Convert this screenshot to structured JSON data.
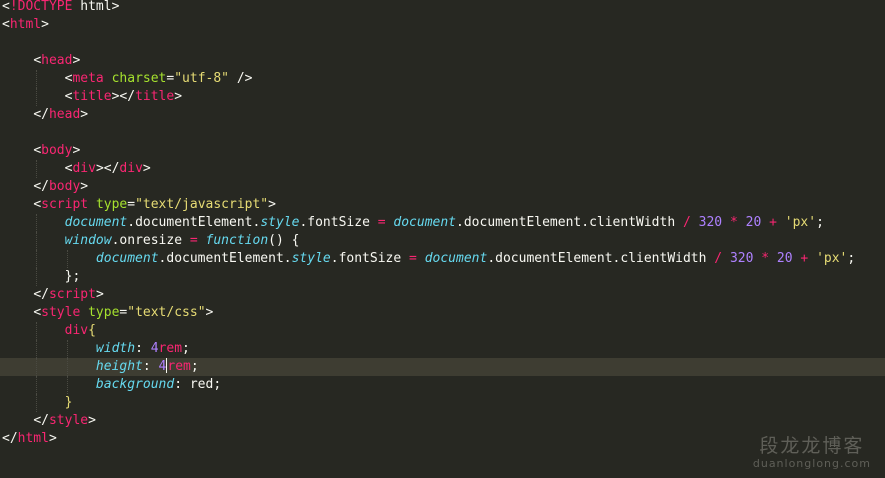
{
  "editor": {
    "theme": "monokai",
    "colors": {
      "background": "#272822",
      "active_line": "#3E3D32",
      "tag": "#F92672",
      "attribute": "#A6E22E",
      "string": "#E6DB74",
      "keyword_italic": "#66D9EF",
      "number": "#AE81FF",
      "text": "#F8F8F2"
    },
    "active_line_index": 20,
    "lines": [
      [
        {
          "c": "tok-punct",
          "t": "<"
        },
        {
          "c": "tok-tag",
          "t": "!DOCTYPE"
        },
        {
          "c": "tok-text",
          "t": " html>"
        }
      ],
      [
        {
          "c": "tok-punct",
          "t": "<"
        },
        {
          "c": "tok-tag",
          "t": "html"
        },
        {
          "c": "tok-punct",
          "t": ">"
        }
      ],
      [],
      [
        {
          "c": "tok-text",
          "t": "    "
        },
        {
          "c": "tok-punct",
          "t": "<"
        },
        {
          "c": "tok-tag",
          "t": "head"
        },
        {
          "c": "tok-punct",
          "t": ">"
        }
      ],
      [
        {
          "c": "tok-text",
          "t": "        "
        },
        {
          "c": "tok-punct",
          "t": "<"
        },
        {
          "c": "tok-tag",
          "t": "meta"
        },
        {
          "c": "tok-text",
          "t": " "
        },
        {
          "c": "tok-attr",
          "t": "charset"
        },
        {
          "c": "tok-punct",
          "t": "="
        },
        {
          "c": "tok-str",
          "t": "\"utf-8\""
        },
        {
          "c": "tok-text",
          "t": " />"
        }
      ],
      [
        {
          "c": "tok-text",
          "t": "        "
        },
        {
          "c": "tok-punct",
          "t": "<"
        },
        {
          "c": "tok-tag",
          "t": "title"
        },
        {
          "c": "tok-punct",
          "t": "></"
        },
        {
          "c": "tok-tag",
          "t": "title"
        },
        {
          "c": "tok-punct",
          "t": ">"
        }
      ],
      [
        {
          "c": "tok-text",
          "t": "    "
        },
        {
          "c": "tok-punct",
          "t": "</"
        },
        {
          "c": "tok-tag",
          "t": "head"
        },
        {
          "c": "tok-punct",
          "t": ">"
        }
      ],
      [],
      [
        {
          "c": "tok-text",
          "t": "    "
        },
        {
          "c": "tok-punct",
          "t": "<"
        },
        {
          "c": "tok-tag",
          "t": "body"
        },
        {
          "c": "tok-punct",
          "t": ">"
        }
      ],
      [
        {
          "c": "tok-text",
          "t": "        "
        },
        {
          "c": "tok-punct",
          "t": "<"
        },
        {
          "c": "tok-tag",
          "t": "div"
        },
        {
          "c": "tok-punct",
          "t": "></"
        },
        {
          "c": "tok-tag",
          "t": "div"
        },
        {
          "c": "tok-punct",
          "t": ">"
        }
      ],
      [
        {
          "c": "tok-text",
          "t": "    "
        },
        {
          "c": "tok-punct",
          "t": "</"
        },
        {
          "c": "tok-tag",
          "t": "body"
        },
        {
          "c": "tok-punct",
          "t": ">"
        }
      ],
      [
        {
          "c": "tok-text",
          "t": "    "
        },
        {
          "c": "tok-punct",
          "t": "<"
        },
        {
          "c": "tok-tag",
          "t": "script"
        },
        {
          "c": "tok-text",
          "t": " "
        },
        {
          "c": "tok-attr",
          "t": "type"
        },
        {
          "c": "tok-punct",
          "t": "="
        },
        {
          "c": "tok-str",
          "t": "\"text/javascript\""
        },
        {
          "c": "tok-punct",
          "t": ">"
        }
      ],
      [
        {
          "c": "tok-text",
          "t": "        "
        },
        {
          "c": "tok-var",
          "t": "document"
        },
        {
          "c": "tok-prop",
          "t": ".documentElement."
        },
        {
          "c": "tok-ital",
          "t": "style"
        },
        {
          "c": "tok-prop",
          "t": ".fontSize "
        },
        {
          "c": "tok-op",
          "t": "="
        },
        {
          "c": "tok-text",
          "t": " "
        },
        {
          "c": "tok-var",
          "t": "document"
        },
        {
          "c": "tok-prop",
          "t": ".documentElement.clientWidth "
        },
        {
          "c": "tok-op",
          "t": "/"
        },
        {
          "c": "tok-text",
          "t": " "
        },
        {
          "c": "tok-num",
          "t": "320"
        },
        {
          "c": "tok-text",
          "t": " "
        },
        {
          "c": "tok-op",
          "t": "*"
        },
        {
          "c": "tok-text",
          "t": " "
        },
        {
          "c": "tok-num",
          "t": "20"
        },
        {
          "c": "tok-text",
          "t": " "
        },
        {
          "c": "tok-op",
          "t": "+"
        },
        {
          "c": "tok-text",
          "t": " "
        },
        {
          "c": "tok-str",
          "t": "'px'"
        },
        {
          "c": "tok-text",
          "t": ";"
        }
      ],
      [
        {
          "c": "tok-text",
          "t": "        "
        },
        {
          "c": "tok-var",
          "t": "window"
        },
        {
          "c": "tok-prop",
          "t": ".onresize "
        },
        {
          "c": "tok-op",
          "t": "="
        },
        {
          "c": "tok-text",
          "t": " "
        },
        {
          "c": "tok-func",
          "t": "function"
        },
        {
          "c": "tok-text",
          "t": "() {"
        }
      ],
      [
        {
          "c": "tok-text",
          "t": "            "
        },
        {
          "c": "tok-var",
          "t": "document"
        },
        {
          "c": "tok-prop",
          "t": ".documentElement."
        },
        {
          "c": "tok-ital",
          "t": "style"
        },
        {
          "c": "tok-prop",
          "t": ".fontSize "
        },
        {
          "c": "tok-op",
          "t": "="
        },
        {
          "c": "tok-text",
          "t": " "
        },
        {
          "c": "tok-var",
          "t": "document"
        },
        {
          "c": "tok-prop",
          "t": ".documentElement.clientWidth "
        },
        {
          "c": "tok-op",
          "t": "/"
        },
        {
          "c": "tok-text",
          "t": " "
        },
        {
          "c": "tok-num",
          "t": "320"
        },
        {
          "c": "tok-text",
          "t": " "
        },
        {
          "c": "tok-op",
          "t": "*"
        },
        {
          "c": "tok-text",
          "t": " "
        },
        {
          "c": "tok-num",
          "t": "20"
        },
        {
          "c": "tok-text",
          "t": " "
        },
        {
          "c": "tok-op",
          "t": "+"
        },
        {
          "c": "tok-text",
          "t": " "
        },
        {
          "c": "tok-str",
          "t": "'px'"
        },
        {
          "c": "tok-text",
          "t": ";"
        }
      ],
      [
        {
          "c": "tok-text",
          "t": "        };"
        }
      ],
      [
        {
          "c": "tok-text",
          "t": "    "
        },
        {
          "c": "tok-punct",
          "t": "</"
        },
        {
          "c": "tok-tag",
          "t": "script"
        },
        {
          "c": "tok-punct",
          "t": ">"
        }
      ],
      [
        {
          "c": "tok-text",
          "t": "    "
        },
        {
          "c": "tok-punct",
          "t": "<"
        },
        {
          "c": "tok-tag",
          "t": "style"
        },
        {
          "c": "tok-text",
          "t": " "
        },
        {
          "c": "tok-attr",
          "t": "type"
        },
        {
          "c": "tok-punct",
          "t": "="
        },
        {
          "c": "tok-str",
          "t": "\"text/css\""
        },
        {
          "c": "tok-punct",
          "t": ">"
        }
      ],
      [
        {
          "c": "tok-text",
          "t": "        "
        },
        {
          "c": "tok-sel",
          "t": "div"
        },
        {
          "c": "tok-brace",
          "t": "{"
        }
      ],
      [
        {
          "c": "tok-text",
          "t": "            "
        },
        {
          "c": "tok-cssprop",
          "t": "width"
        },
        {
          "c": "tok-text",
          "t": ": "
        },
        {
          "c": "tok-num",
          "t": "4"
        },
        {
          "c": "tok-unit",
          "t": "rem"
        },
        {
          "c": "tok-text",
          "t": ";"
        }
      ],
      [
        {
          "c": "tok-text",
          "t": "            "
        },
        {
          "c": "tok-cssprop",
          "t": "height"
        },
        {
          "c": "tok-text",
          "t": ": "
        },
        {
          "c": "tok-num",
          "t": "4"
        },
        {
          "c": "caret",
          "t": ""
        },
        {
          "c": "tok-unit",
          "t": "rem"
        },
        {
          "c": "tok-text",
          "t": ";"
        }
      ],
      [
        {
          "c": "tok-text",
          "t": "            "
        },
        {
          "c": "tok-cssprop",
          "t": "background"
        },
        {
          "c": "tok-text",
          "t": ": red;"
        }
      ],
      [
        {
          "c": "tok-text",
          "t": "        "
        },
        {
          "c": "tok-brace",
          "t": "}"
        }
      ],
      [
        {
          "c": "tok-text",
          "t": "    "
        },
        {
          "c": "tok-punct",
          "t": "</"
        },
        {
          "c": "tok-tag",
          "t": "style"
        },
        {
          "c": "tok-punct",
          "t": ">"
        }
      ],
      [
        {
          "c": "tok-punct",
          "t": "</"
        },
        {
          "c": "tok-tag",
          "t": "html"
        },
        {
          "c": "tok-punct",
          "t": ">"
        }
      ]
    ]
  },
  "watermark": {
    "title": "段龙龙博客",
    "subtitle": "duanlonglong.com"
  }
}
